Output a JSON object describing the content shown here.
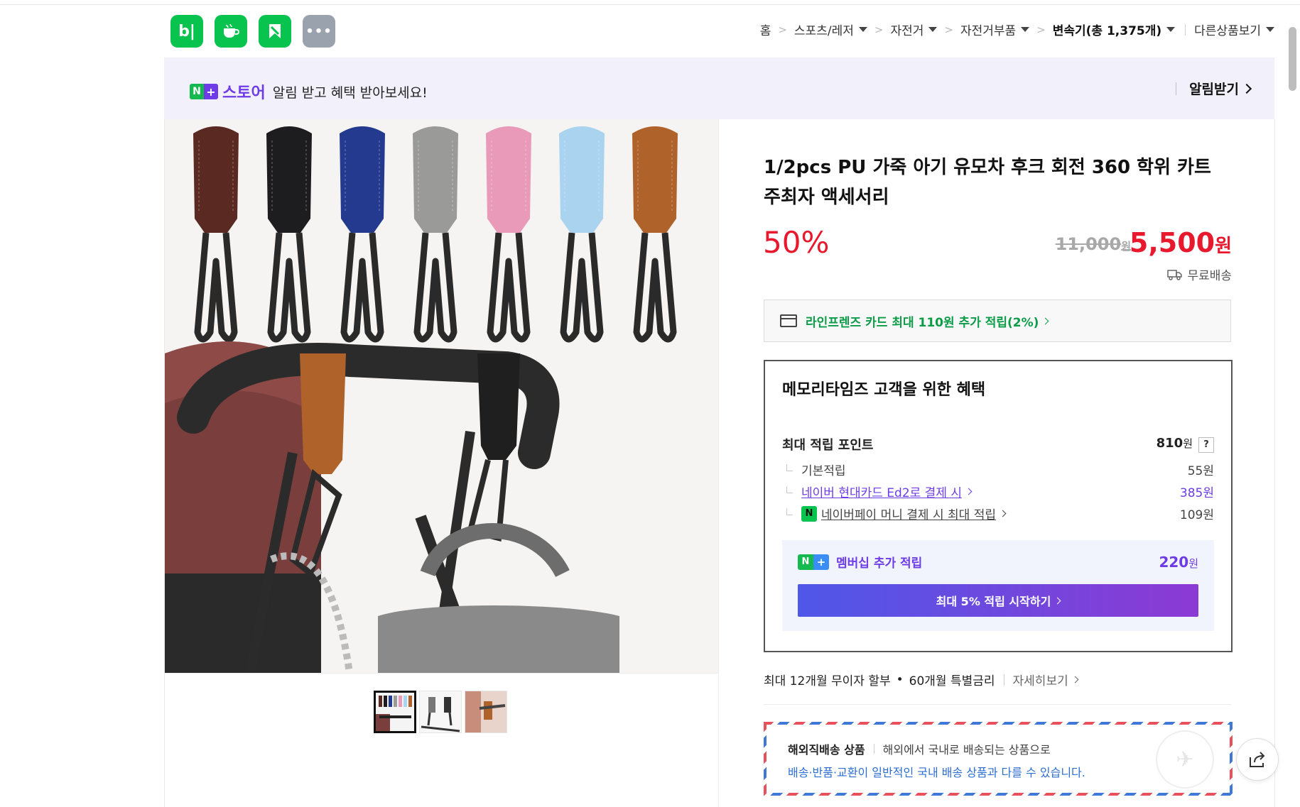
{
  "apps": [
    {
      "name": "blog-app-icon",
      "glyph": "b|"
    },
    {
      "name": "cafe-app-icon",
      "glyph": "☕"
    },
    {
      "name": "bookmark-app-icon",
      "glyph": "🔖"
    },
    {
      "name": "more-apps-icon",
      "glyph": "•••"
    }
  ],
  "breadcrumb": {
    "home": "홈",
    "sports": "스포츠/레저",
    "bicycle": "자전거",
    "parts": "자전거부품",
    "current": "변속기(총 1,375개)",
    "other": "다른상품보기"
  },
  "banner": {
    "store_badge_n": "N",
    "store_badge_plus": "+",
    "store_name": "스토어",
    "message": "알림 받고 혜택 받아보세요!",
    "action": "알림받기"
  },
  "product": {
    "title": "1/2pcs PU 가죽 아기 유모차 후크 회전 360 학위 카트 주최자 액세서리",
    "discount": "50%",
    "original_price": "11,000",
    "original_unit": "원",
    "price": "5,500",
    "price_unit": "원",
    "shipping": "무료배송",
    "hook_colors": [
      "#5a2a22",
      "#1d1d1f",
      "#243a8e",
      "#9a9a98",
      "#e89ab8",
      "#a9d3ef",
      "#b0622b"
    ]
  },
  "card_promo": "라인프렌즈 카드 최대 110원 추가 적립(2%)",
  "benefit": {
    "heading": "메모리타임즈 고객을 위한 혜택",
    "max_points_label": "최대 적립 포인트",
    "max_points_value": "810",
    "max_points_unit": "원",
    "help": "?",
    "rows": [
      {
        "label": "기본적립",
        "value": "55원"
      },
      {
        "label": "네이버 현대카드 Ed2로 결제 시",
        "value": "385원"
      },
      {
        "label": "네이버페이 머니 결제 시 최대 적립",
        "value": "109원"
      }
    ],
    "npay_badge": "N",
    "membership": {
      "badge_n": "N",
      "badge_plus": "+",
      "label": "멤버십 추가 적립",
      "value": "220",
      "unit": "원",
      "button": "최대 5% 적립 시작하기"
    }
  },
  "installment": {
    "text1": "최대 12개월 무이자 할부",
    "dot": "•",
    "text2": "60개월 특별금리",
    "more": "자세히보기"
  },
  "overseas": {
    "title": "해외직배송 상품",
    "desc": "해외에서 국내로 배송되는 상품으로",
    "note": "배송·반품·교환이 일반적인 국내 배송 상품과 다를 수 있습니다."
  }
}
